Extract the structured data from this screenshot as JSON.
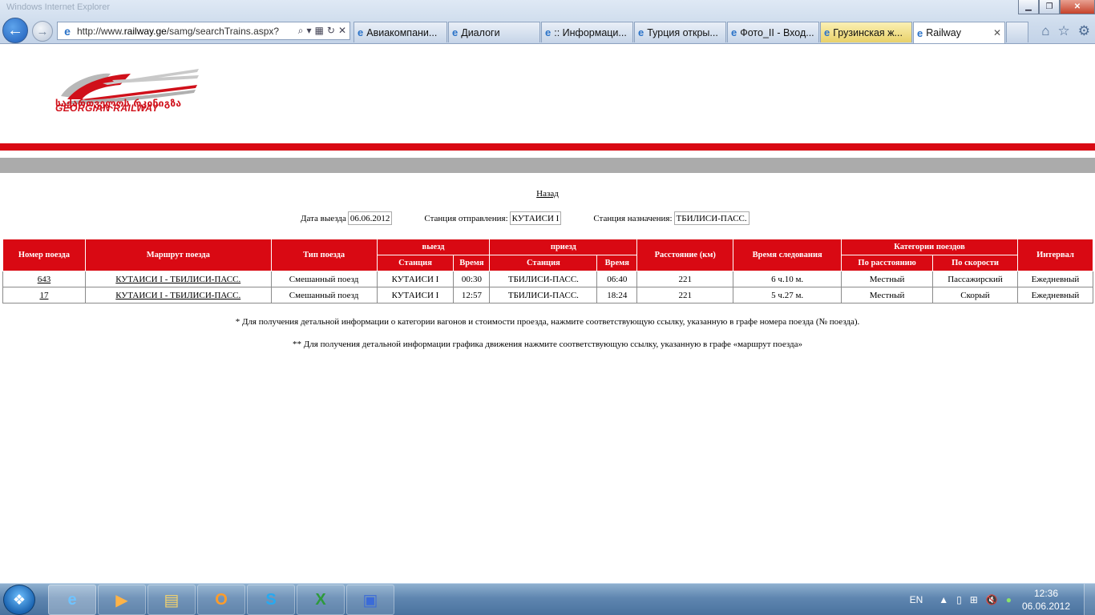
{
  "window": {
    "title": "Windows Internet Explorer"
  },
  "browser": {
    "url_prefix": "http://www.",
    "url_domain": "railway.ge",
    "url_path": "/samg/searchTrains.aspx?",
    "tabs": [
      {
        "label": "Авиакомпани...",
        "highlight": false,
        "active": false
      },
      {
        "label": "Диалоги",
        "highlight": false,
        "active": false
      },
      {
        "label": ":: Информаци...",
        "highlight": false,
        "active": false
      },
      {
        "label": "Турция откры...",
        "highlight": false,
        "active": false
      },
      {
        "label": "Фото_II - Вход...",
        "highlight": false,
        "active": false
      },
      {
        "label": "Грузинская ж...",
        "highlight": true,
        "active": false
      },
      {
        "label": "Railway",
        "highlight": false,
        "active": true
      }
    ]
  },
  "logo": {
    "georgian": "საქართველოს რკინიგზა",
    "english": "GEORGIAN RAILWAY"
  },
  "page": {
    "back_link": "Назад",
    "filters": {
      "date_label": "Дата выезда",
      "date_value": "06.06.2012",
      "from_label": "Станция отправления:",
      "from_value": "КУТАИСИ I",
      "to_label": "Станция назначения:",
      "to_value": "ТБИЛИСИ-ПАСС."
    },
    "table": {
      "headers": {
        "train_no": "Номер поезда",
        "route": "Маршрут поезда",
        "type": "Тип поезда",
        "departure": "выезд",
        "arrival": "приезд",
        "distance": "Расстояние (км)",
        "travel_time": "Время следования",
        "categories": "Категории поездов",
        "interval": "Интервал",
        "station": "Станция",
        "time": "Время",
        "by_distance": "По расстоянию",
        "by_speed": "По скорости"
      },
      "rows": [
        {
          "train_no": "643",
          "route": "КУТАИСИ I - ТБИЛИСИ-ПАСС.",
          "type": "Смешанный поезд",
          "dep_station": "КУТАИСИ I",
          "dep_time": "00:30",
          "arr_station": "ТБИЛИСИ-ПАСС.",
          "arr_time": "06:40",
          "distance": "221",
          "travel_time": "6 ч.10 м.",
          "cat_distance": "Местный",
          "cat_speed": "Пассажирский",
          "interval": "Ежедневный"
        },
        {
          "train_no": "17",
          "route": "КУТАИСИ I - ТБИЛИСИ-ПАСС.",
          "type": "Смешанный поезд",
          "dep_station": "КУТАИСИ I",
          "dep_time": "12:57",
          "arr_station": "ТБИЛИСИ-ПАСС.",
          "arr_time": "18:24",
          "distance": "221",
          "travel_time": "5 ч.27 м.",
          "cat_distance": "Местный",
          "cat_speed": "Скорый",
          "interval": "Ежедневный"
        }
      ]
    },
    "note1": "* Для получения детальной информации о категории вагонов и стоимости проезда, нажмите соответствующую ссылку, указанную в графе номера поезда (№ поезда).",
    "note2": "** Для получения детальной информации графика движения нажмите соответствующую ссылку, указанную в графе «маршрут поезда»"
  },
  "taskbar": {
    "apps": [
      "internet-explorer-icon",
      "media-player-icon",
      "explorer-folder-icon",
      "outlook-icon",
      "skype-icon",
      "excel-icon",
      "app-icon"
    ],
    "language": "EN",
    "time": "12:36",
    "date": "06.06.2012"
  },
  "colors": {
    "brand_red": "#d90913",
    "gray_bar": "#ababab"
  }
}
